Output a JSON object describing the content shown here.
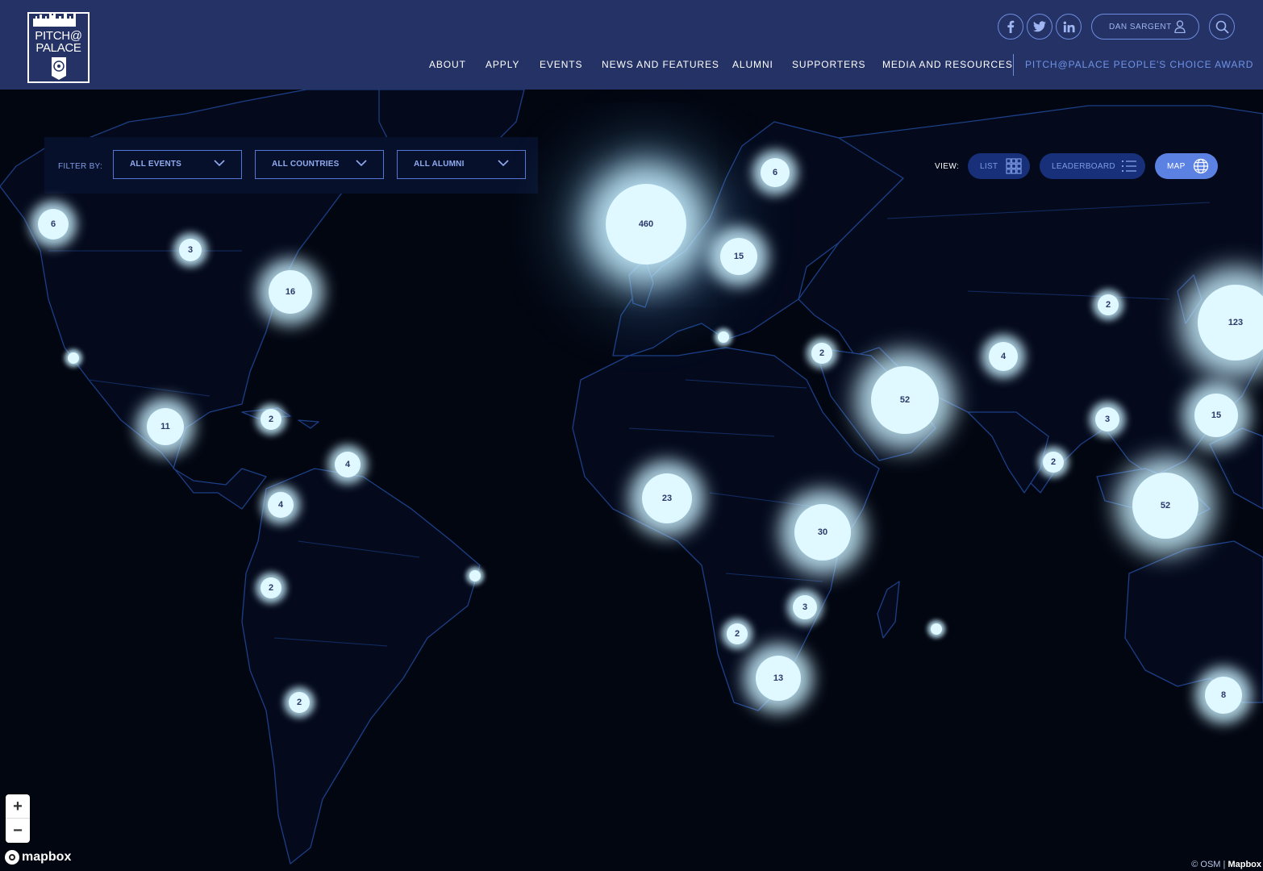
{
  "header": {
    "logo": {
      "line1": "PITCH@",
      "line2": "PALACE"
    },
    "social": [
      {
        "name": "facebook-icon",
        "glyph": "f"
      },
      {
        "name": "twitter-icon",
        "glyph": "🐦"
      },
      {
        "name": "linkedin-icon",
        "glyph": "in"
      }
    ],
    "user": {
      "label": "DAN SARGENT",
      "icon": "user-icon"
    },
    "search_icon": "search-icon",
    "nav": [
      "ABOUT",
      "APPLY",
      "EVENTS",
      "NEWS AND FEATURES",
      "ALUMNI",
      "SUPPORTERS",
      "MEDIA AND RESOURCES"
    ],
    "award_link": "PITCH@PALACE PEOPLE'S CHOICE AWARD"
  },
  "filters": {
    "label": "FILTER BY:",
    "events": "ALL EVENTS",
    "countries": "ALL COUNTRIES",
    "alumni": "ALL ALUMNI"
  },
  "view": {
    "label": "VIEW:",
    "list": "LIST",
    "leaderboard": "LEADERBOARD",
    "map": "MAP",
    "active": "MAP"
  },
  "clusters": [
    "460",
    "6",
    "15",
    "6",
    "3",
    "16",
    "11",
    "2",
    "4",
    "4",
    "2",
    "2",
    "23",
    "30",
    "3",
    "2",
    "13",
    "52",
    "2",
    "4",
    "2",
    "3",
    "2",
    "123",
    "15",
    "52",
    "8",
    "",
    "",
    "",
    ""
  ],
  "colors": {
    "header_bg": "#243266",
    "map_bg": "#020611",
    "cluster_glow": "#e0f8ff",
    "accent": "#5b82e3",
    "award_link": "#6f93e6"
  },
  "map_controls": {
    "zoom_in": "+",
    "zoom_out": "−"
  },
  "attribution": {
    "brand": "mapbox",
    "osm": "© OSM",
    "separator": "|",
    "mapbox": "Mapbox"
  }
}
